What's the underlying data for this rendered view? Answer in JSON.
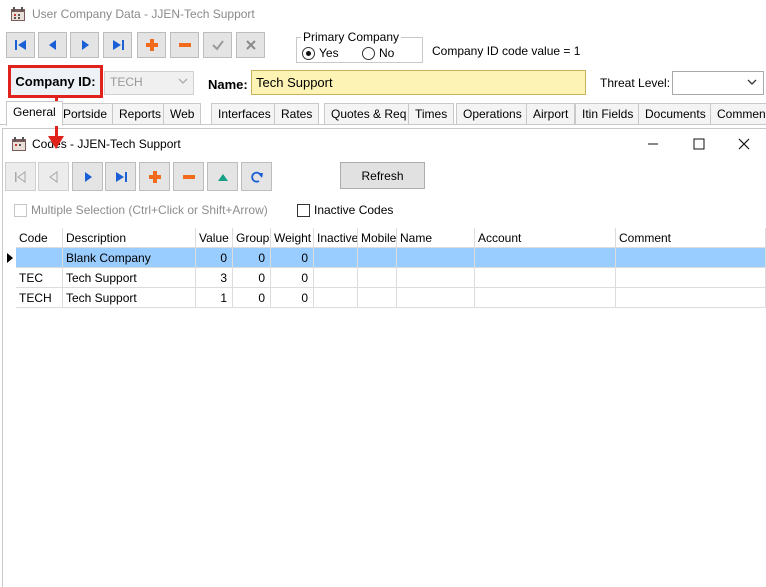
{
  "back_window": {
    "title": "User Company Data - JJEN-Tech Support",
    "nav_buttons": [
      {
        "name": "first-record-button",
        "icon": "first-icon"
      },
      {
        "name": "prev-record-button",
        "icon": "prev-icon"
      },
      {
        "name": "next-record-button",
        "icon": "next-icon"
      },
      {
        "name": "last-record-button",
        "icon": "last-icon"
      },
      {
        "name": "add-record-button",
        "icon": "plus-icon"
      },
      {
        "name": "delete-record-button",
        "icon": "minus-icon"
      },
      {
        "name": "post-record-button",
        "icon": "check-icon"
      },
      {
        "name": "cancel-record-button",
        "icon": "x-icon"
      }
    ],
    "primary_company": {
      "legend": "Primary Company",
      "yes_label": "Yes",
      "no_label": "No",
      "selected": "Yes"
    },
    "company_id_code_text": "Company ID code value = 1",
    "company_id_label": "Company ID:",
    "company_id_value": "TECH",
    "name_label": "Name:",
    "name_value": "Tech Support",
    "threat_level_label": "Threat Level:",
    "threat_level_value": "",
    "tabs": [
      "General",
      "Portside",
      "Reports",
      "Web",
      "Interfaces",
      "Rates",
      "Quotes & Req",
      "Times",
      "Operations",
      "Airport",
      "Itin Fields",
      "Documents",
      "Commen"
    ],
    "active_tab": "General"
  },
  "codes_window": {
    "title": "Codes - JJEN-Tech Support",
    "toolbar": {
      "refresh_label": "Refresh"
    },
    "multiple_selection_label": "Multiple Selection (Ctrl+Click or Shift+Arrow)",
    "inactive_codes_label": "Inactive Codes",
    "grid": {
      "columns": [
        "Code",
        "Description",
        "Value",
        "Group",
        "Weight",
        "Inactive",
        "Mobile",
        "Name",
        "Account",
        "Comment"
      ],
      "rows": [
        {
          "code": "",
          "description": "Blank Company",
          "value": "0",
          "group": "0",
          "weight": "0",
          "inactive": "",
          "mobile": "",
          "name": "",
          "account": "",
          "comment": "",
          "selected": true
        },
        {
          "code": "TEC",
          "description": "Tech Support",
          "value": "3",
          "group": "0",
          "weight": "0",
          "inactive": "",
          "mobile": "",
          "name": "",
          "account": "",
          "comment": "",
          "selected": false
        },
        {
          "code": "TECH",
          "description": "Tech Support",
          "value": "1",
          "group": "0",
          "weight": "0",
          "inactive": "",
          "mobile": "",
          "name": "",
          "account": "",
          "comment": "",
          "selected": false
        }
      ]
    }
  },
  "colors": {
    "highlight_red": "#e0211c",
    "name_field_bg": "#fcf3b4",
    "selected_row": "#99ccff",
    "nav_arrow_blue": "#1a5fd6",
    "add_orange": "#f26a1b"
  }
}
